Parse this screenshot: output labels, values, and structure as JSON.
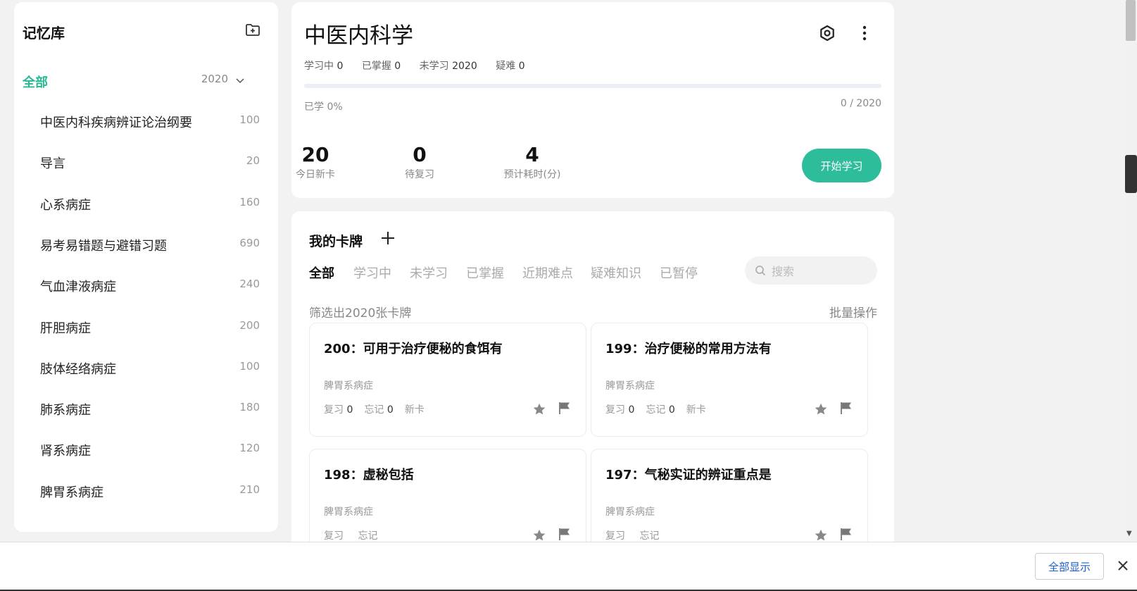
{
  "sidebar": {
    "title": "记忆库",
    "all": {
      "label": "全部",
      "count": "2020"
    },
    "items": [
      {
        "label": "中医内科疾病辨证论治纲要",
        "count": "100"
      },
      {
        "label": "导言",
        "count": "20"
      },
      {
        "label": "心系病症",
        "count": "160"
      },
      {
        "label": "易考易错题与避错习题",
        "count": "690"
      },
      {
        "label": "气血津液病症",
        "count": "240"
      },
      {
        "label": "肝胆病症",
        "count": "200"
      },
      {
        "label": "肢体经络病症",
        "count": "100"
      },
      {
        "label": "肺系病症",
        "count": "180"
      },
      {
        "label": "肾系病症",
        "count": "120"
      },
      {
        "label": "脾胃系病症",
        "count": "210"
      }
    ]
  },
  "deck": {
    "title": "中医内科学",
    "meta": [
      {
        "label": "学习中",
        "value": "0"
      },
      {
        "label": "已掌握",
        "value": "0"
      },
      {
        "label": "未学习",
        "value": "2020"
      },
      {
        "label": "疑难",
        "value": "0"
      }
    ],
    "progress": 0,
    "learned_text": "已学 0%",
    "progress_count": "0 / 2020",
    "stats": [
      {
        "value": "20",
        "label": "今日新卡"
      },
      {
        "value": "0",
        "label": "待复习"
      },
      {
        "value": "4",
        "label": "预计耗时(分)"
      }
    ],
    "start_label": "开始学习"
  },
  "cards_panel": {
    "title": "我的卡牌",
    "tabs": [
      "全部",
      "学习中",
      "未学习",
      "已掌握",
      "近期难点",
      "疑难知识",
      "已暂停"
    ],
    "search_placeholder": "搜索",
    "filtered_text": "筛选出2020张卡牌",
    "batch_label": "批量操作",
    "review_label": "复习",
    "forget_label": "忘记",
    "cards": [
      {
        "question": "200：可用于治疗便秘的食饵有",
        "category": "脾胃系病症",
        "review": "0",
        "forget": "0",
        "status": "新卡"
      },
      {
        "question": "199：治疗便秘的常用方法有",
        "category": "脾胃系病症",
        "review": "0",
        "forget": "0",
        "status": "新卡"
      },
      {
        "question": "198：虚秘包括",
        "category": "脾胃系病症",
        "review": "",
        "forget": "",
        "status": ""
      },
      {
        "question": "197：气秘实证的辨证重点是",
        "category": "脾胃系病症",
        "review": "",
        "forget": "",
        "status": ""
      }
    ]
  },
  "bottom_bar": {
    "show_all_label": "全部显示"
  },
  "colors": {
    "accent": "#28b795",
    "button": "#2dbd9a",
    "link": "#1a5fd0"
  }
}
